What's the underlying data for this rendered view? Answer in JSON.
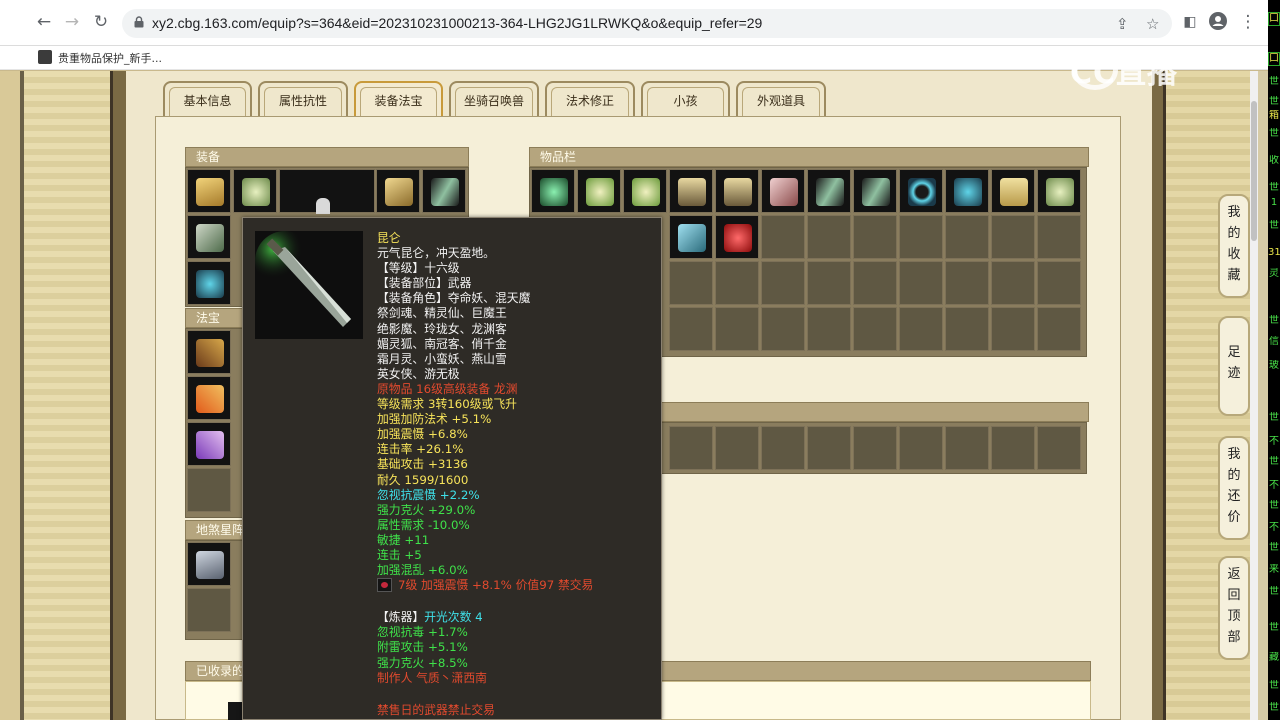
{
  "browser": {
    "url": "xy2.cbg.163.com/equip?s=364&eid=202310231000213-364-LHG2JG1LRWKQ&o&equip_refer=29",
    "bookmark_label": "贵重物品保护_新手..."
  },
  "watermark": "CC直播",
  "tabs": [
    {
      "label": "基本信息"
    },
    {
      "label": "属性抗性"
    },
    {
      "label": "装备法宝"
    },
    {
      "label": "坐骑召唤兽"
    },
    {
      "label": "法术修正"
    },
    {
      "label": "小孩"
    },
    {
      "label": "外观道具"
    }
  ],
  "sections": {
    "equipment": "装备",
    "treasure": "法宝",
    "earth_star": "地煞星阵",
    "inventory": "物品栏",
    "collected": "已收录的"
  },
  "tooltip": {
    "name": "昆仑",
    "desc": "元气昆仑，冲天盈地。",
    "level": "【等级】十六级",
    "slot": "【装备部位】武器",
    "roles_1": "【装备角色】夺命妖、混天魔",
    "roles_2": "祭剑魂、精灵仙、巨魔王",
    "roles_3": "绝影魔、玲珑女、龙渊客",
    "roles_4": "媚灵狐、南冠客、俏千金",
    "roles_5": "霜月灵、小蛮妖、燕山雪",
    "roles_6": "英女侠、游无极",
    "origin": "原物品 16级高级装备 龙渊",
    "requirement": "等级需求 3转160级或飞升",
    "stat_1": "加强加防法术 +5.1%",
    "stat_2": "加强震慑 +6.8%",
    "stat_3": "连击率 +26.1%",
    "stat_4": "基础攻击 +3136",
    "stat_5": "耐久 1599/1600",
    "stat_6": "忽视抗震慑 +2.2%",
    "stat_7": "强力克火 +29.0%",
    "stat_8": "属性需求 -10.0%",
    "stat_9": "敏捷 +11",
    "stat_10": "连击 +5",
    "stat_11": "加强混乱 +6.0%",
    "gem": "7级 加强震慑 +8.1% 价值97 禁交易",
    "refine_label": "【炼器】",
    "refine_count": "开光次数 4",
    "refine_1": "忽视抗毒 +1.7%",
    "refine_2": "附雷攻击 +5.1%",
    "refine_3": "强力克火 +8.5%",
    "maker": "制作人 气质丶潇西南",
    "bottom": "禁售日的武器禁止交易"
  },
  "side_menu": [
    {
      "chars": [
        "我",
        "的",
        "收",
        "藏"
      ]
    },
    {
      "chars": [
        "足",
        "迹"
      ]
    },
    {
      "chars": [
        "我",
        "的",
        "还",
        "价"
      ]
    },
    {
      "chars": [
        "返",
        "回",
        "顶",
        "部"
      ]
    }
  ],
  "right_strip": [
    "口",
    "口",
    "世",
    "世",
    "箱",
    "世",
    "收",
    "世",
    "1",
    "世",
    "31",
    "灵",
    "世",
    "信",
    "玻",
    "世",
    "不",
    "世",
    "不",
    "世",
    "不",
    "世",
    "来",
    "世",
    "世",
    "藏",
    "世",
    "世"
  ]
}
